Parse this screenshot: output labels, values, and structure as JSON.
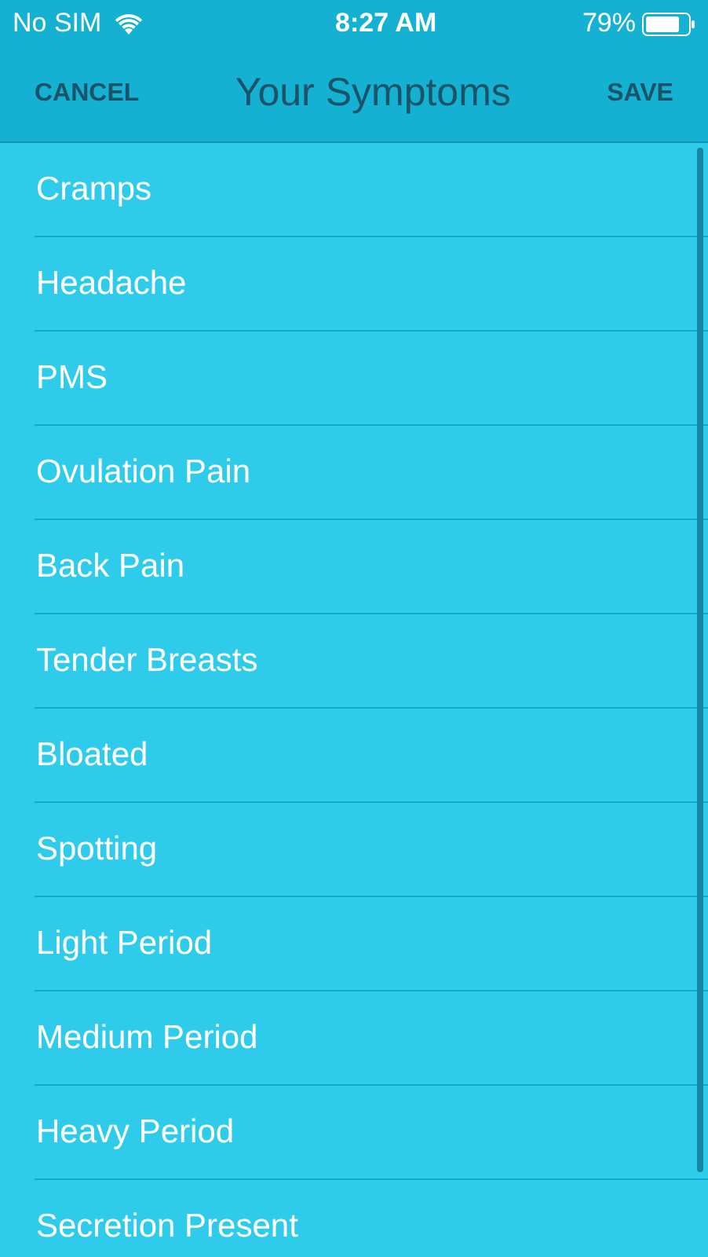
{
  "status_bar": {
    "carrier": "No SIM",
    "time": "8:27 AM",
    "battery": "79%"
  },
  "nav_bar": {
    "cancel": "CANCEL",
    "title": "Your Symptoms",
    "save": "SAVE"
  },
  "symptoms": [
    {
      "label": "Cramps"
    },
    {
      "label": "Headache"
    },
    {
      "label": "PMS"
    },
    {
      "label": "Ovulation Pain"
    },
    {
      "label": "Back Pain"
    },
    {
      "label": "Tender Breasts"
    },
    {
      "label": "Bloated"
    },
    {
      "label": "Spotting"
    },
    {
      "label": "Light Period"
    },
    {
      "label": "Medium Period"
    },
    {
      "label": "Heavy Period"
    },
    {
      "label": "Secretion Present"
    }
  ]
}
